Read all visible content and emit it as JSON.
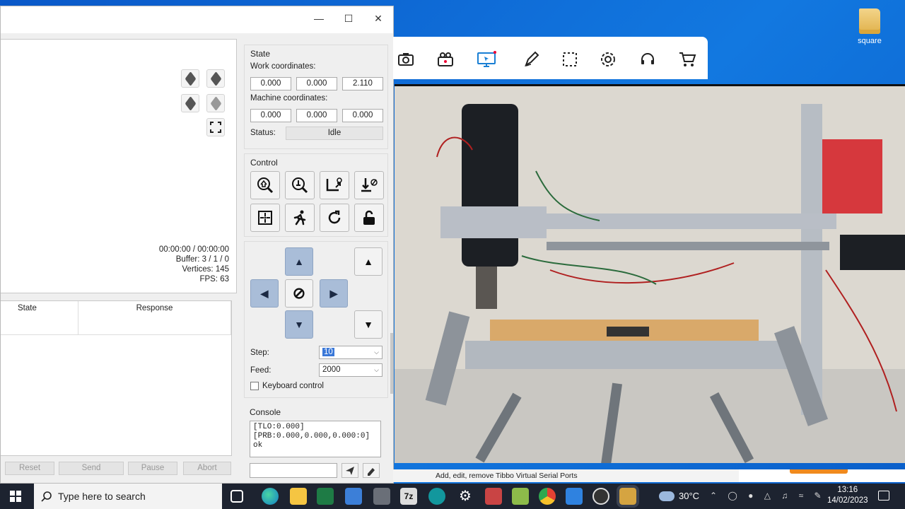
{
  "desktop": {
    "icons": [
      {
        "label": "square"
      }
    ]
  },
  "candle": {
    "window_controls": {
      "minimize": "—",
      "maximize": "☐",
      "close": "✕"
    },
    "visualizer": {
      "time": "00:00:00 / 00:00:00",
      "buffer": "Buffer: 3 / 1 / 0",
      "vertices": "Vertices: 145",
      "fps": "FPS: 63",
      "view_buttons": [
        "cube-view-icon",
        "cube-view-icon",
        "cube-view-icon",
        "cube-view-icon",
        "fit-view-icon"
      ]
    },
    "console_table": {
      "headers": [
        "State",
        "Response"
      ]
    },
    "bottom_buttons": [
      "Reset",
      "Send",
      "Pause",
      "Abort"
    ],
    "state": {
      "title": "State",
      "work_label": "Work coordinates:",
      "work": [
        "0.000",
        "0.000",
        "2.110"
      ],
      "machine_label": "Machine coordinates:",
      "machine": [
        "0.000",
        "0.000",
        "0.000"
      ],
      "status_label": "Status:",
      "status": "Idle"
    },
    "control": {
      "title": "Control",
      "buttons": [
        "home-icon",
        "zero-probe-icon",
        "zero-xy-icon",
        "zero-z-icon",
        "origin-icon",
        "safe-position-icon",
        "reset-icon",
        "unlock-icon"
      ]
    },
    "jog": {
      "arrows": {
        "up": "▲",
        "down": "▼",
        "left": "◀",
        "right": "▶",
        "stop": "⊘"
      },
      "step_label": "Step:",
      "step_value": "10",
      "feed_label": "Feed:",
      "feed_value": "2000",
      "keyboard_label": "Keyboard control"
    },
    "console": {
      "title": "Console",
      "lines": "[TLO:0.000]\n[PRB:0.000,0.000,0.000:0]\nok",
      "send_icon": "send-icon",
      "clear_icon": "eraser-icon"
    }
  },
  "camera_app": {
    "toolbar_icons": [
      "camera-icon",
      "video-icon",
      "screen-cast-icon",
      "pen-icon",
      "select-region-icon",
      "gear-icon",
      "headset-icon",
      "cart-icon"
    ],
    "status_text": "Add, edit, remove Tibbo Virtual Serial Ports"
  },
  "taskbar": {
    "search_placeholder": "Type here to search",
    "temperature": "30°C",
    "time": "13:16",
    "date": "14/02/2023"
  }
}
